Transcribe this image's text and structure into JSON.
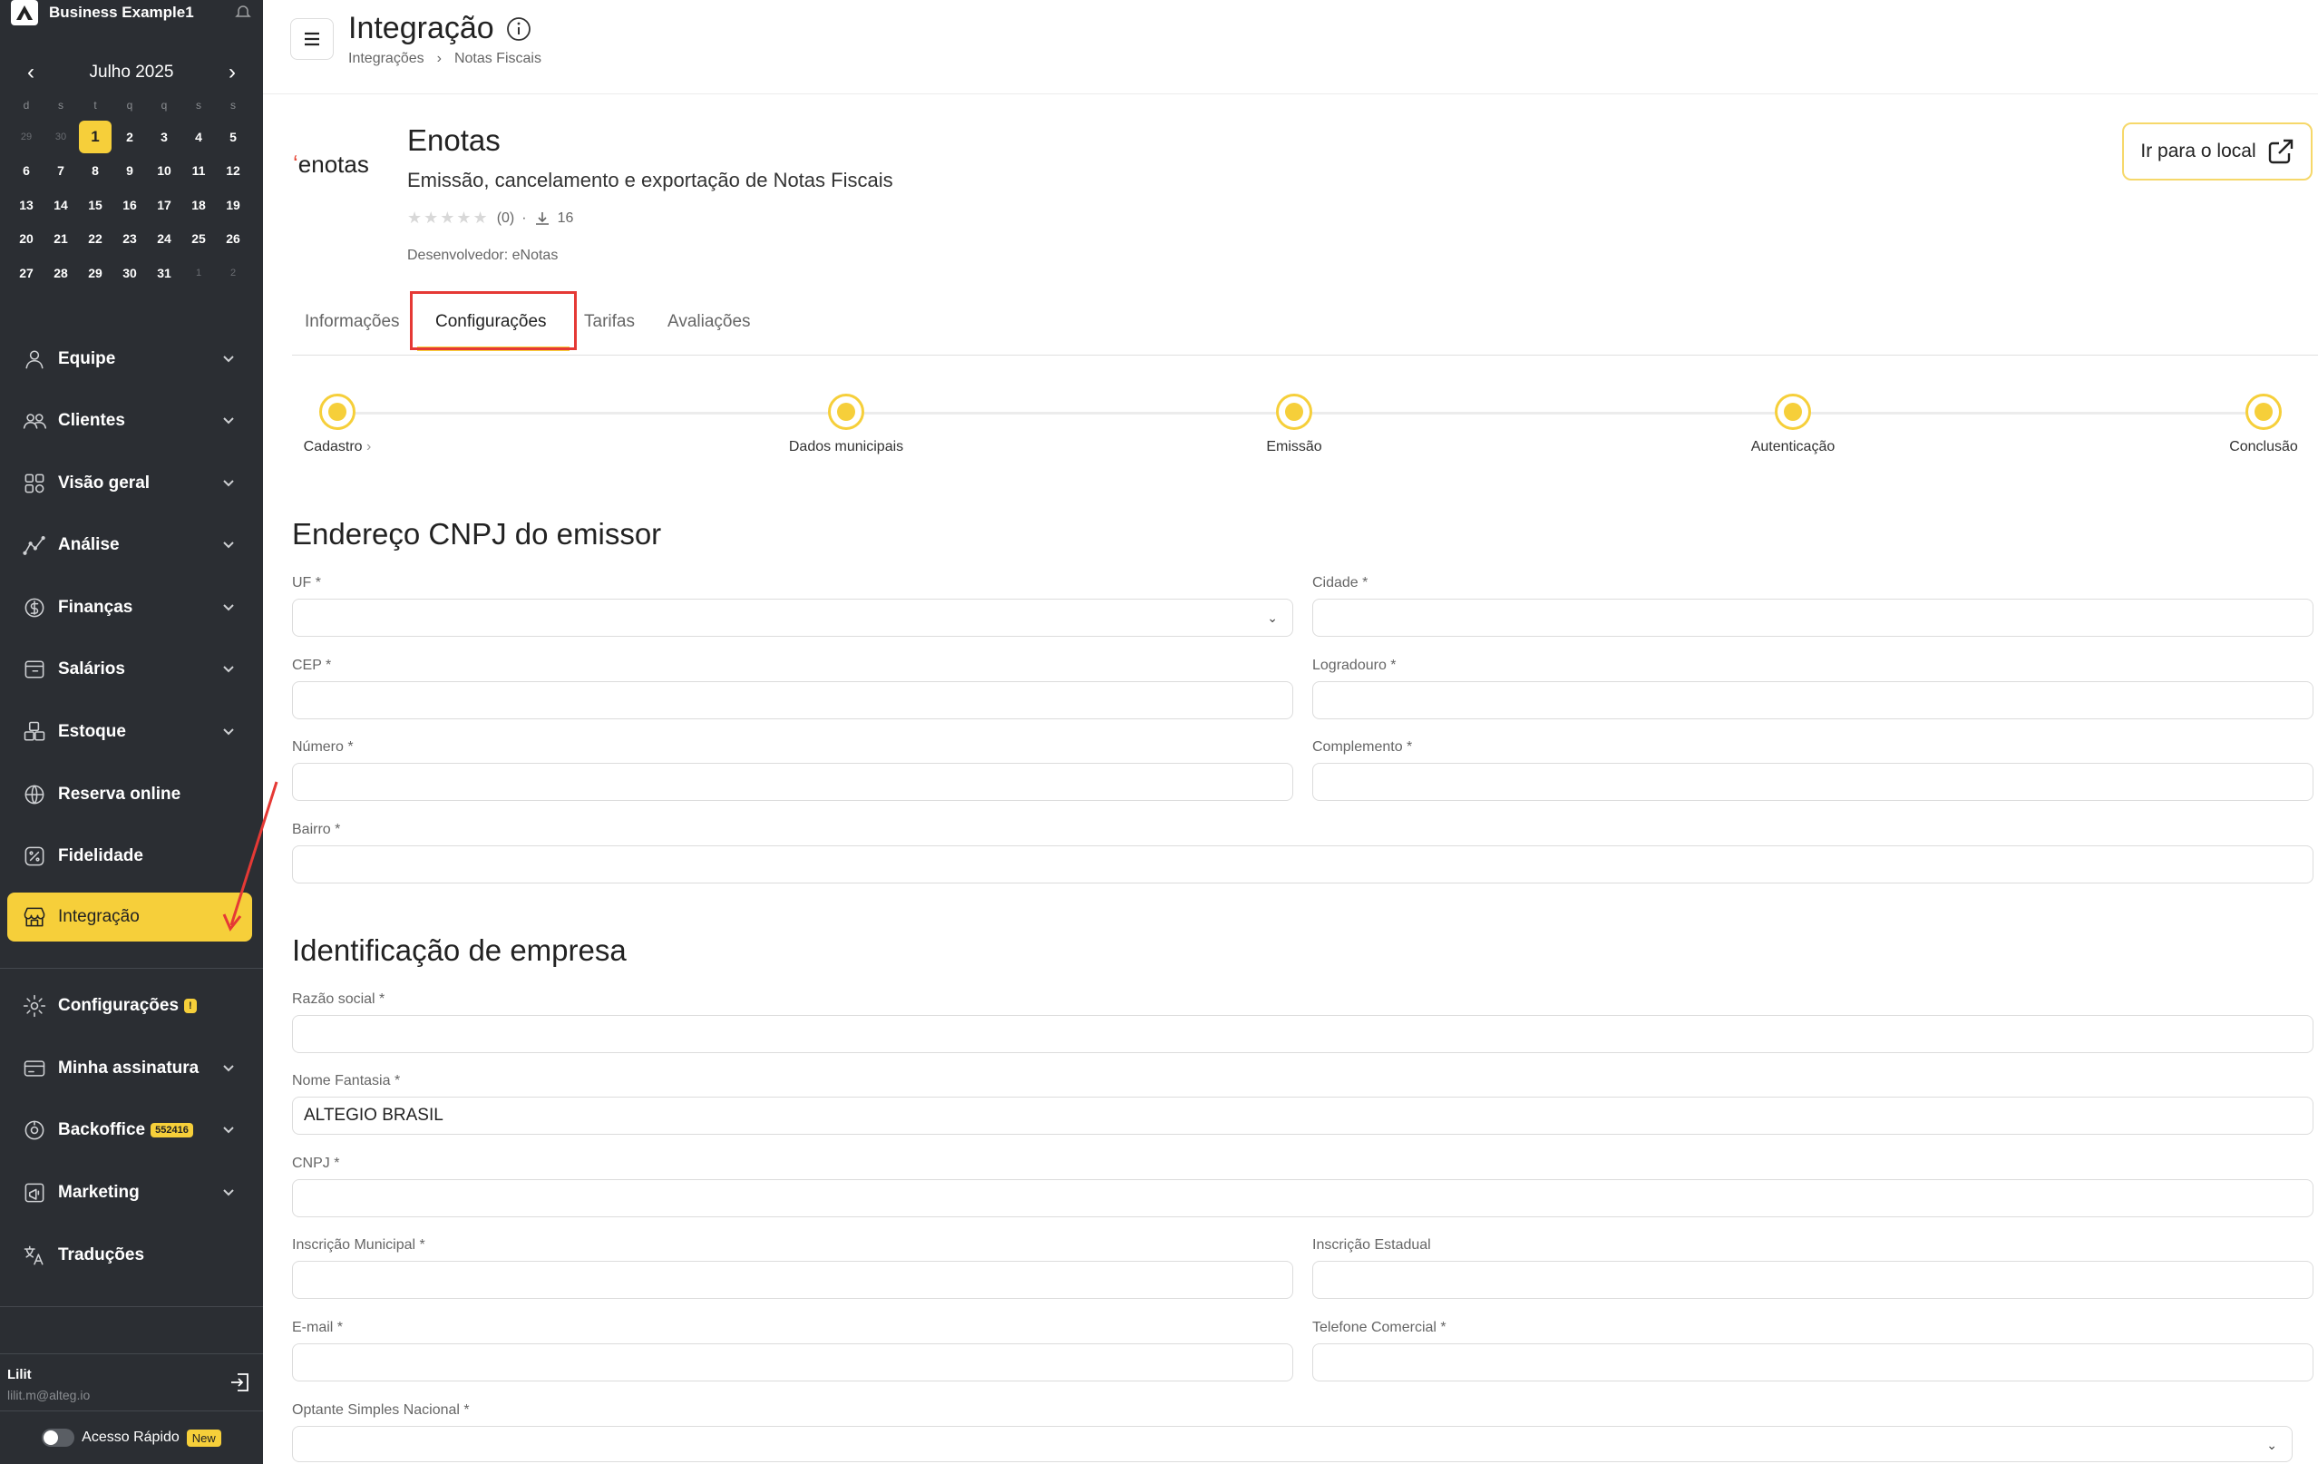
{
  "sidebar": {
    "business_name": "Business Example1",
    "calendar": {
      "month": "Julho 2025",
      "weekdays": [
        "d",
        "s",
        "t",
        "q",
        "q",
        "s",
        "s"
      ],
      "weeks": [
        [
          "29",
          "30",
          "1",
          "2",
          "3",
          "4",
          "5"
        ],
        [
          "6",
          "7",
          "8",
          "9",
          "10",
          "11",
          "12"
        ],
        [
          "13",
          "14",
          "15",
          "16",
          "17",
          "18",
          "19"
        ],
        [
          "20",
          "21",
          "22",
          "23",
          "24",
          "25",
          "26"
        ],
        [
          "27",
          "28",
          "29",
          "30",
          "31",
          "1",
          "2"
        ]
      ],
      "today": "1"
    },
    "items": [
      {
        "label": "Equipe",
        "icon": "user-icon"
      },
      {
        "label": "Clientes",
        "icon": "users-icon"
      },
      {
        "label": "Visão geral",
        "icon": "grid-icon"
      },
      {
        "label": "Análise",
        "icon": "chart-icon"
      },
      {
        "label": "Finanças",
        "icon": "dollar-icon"
      },
      {
        "label": "Salários",
        "icon": "wallet-icon"
      },
      {
        "label": "Estoque",
        "icon": "boxes-icon"
      },
      {
        "label": "Reserva online",
        "icon": "globe-icon"
      },
      {
        "label": "Fidelidade",
        "icon": "percent-icon"
      },
      {
        "label": "Integração",
        "icon": "store-icon"
      },
      {
        "label": "Configurações",
        "icon": "gear-icon",
        "badge": "!"
      },
      {
        "label": "Minha assinatura",
        "icon": "card-icon"
      },
      {
        "label": "Backoffice",
        "icon": "dial-icon",
        "badge": "552416"
      },
      {
        "label": "Marketing",
        "icon": "megaphone-icon"
      },
      {
        "label": "Traduções",
        "icon": "translate-icon"
      }
    ],
    "user": {
      "name": "Lilit",
      "email": "lilit.m@alteg.io"
    },
    "quick_access": {
      "label": "Acesso Rápido",
      "badge": "New"
    }
  },
  "header": {
    "title": "Integração",
    "breadcrumb": [
      "Integrações",
      "Notas Fiscais"
    ]
  },
  "app": {
    "logo_text": "enotas",
    "name": "Enotas",
    "description": "Emissão, cancelamento e exportação de Notas Fiscais",
    "rating_count": "(0)",
    "downloads": "16",
    "developer": "Desenvolvedor: eNotas",
    "go_button": "Ir para o local"
  },
  "tabs": [
    "Informações",
    "Configurações",
    "Tarifas",
    "Avaliações"
  ],
  "steps": [
    "Cadastro",
    "Dados municipais",
    "Emissão",
    "Autenticação",
    "Conclusão"
  ],
  "address_section": {
    "title": "Endereço CNPJ do emissor",
    "fields": {
      "uf": {
        "label": "UF *",
        "value": ""
      },
      "cidade": {
        "label": "Cidade *",
        "value": ""
      },
      "cep": {
        "label": "CEP *",
        "value": ""
      },
      "logradouro": {
        "label": "Logradouro *",
        "value": ""
      },
      "numero": {
        "label": "Número *",
        "value": ""
      },
      "complemento": {
        "label": "Complemento *",
        "value": ""
      },
      "bairro": {
        "label": "Bairro *",
        "value": ""
      }
    }
  },
  "company_section": {
    "title": "Identificação de empresa",
    "fields": {
      "razao": {
        "label": "Razão social *",
        "value": ""
      },
      "fantasia": {
        "label": "Nome Fantasia *",
        "value": "ALTEGIO BRASIL"
      },
      "cnpj": {
        "label": "CNPJ *",
        "value": ""
      },
      "im": {
        "label": "Inscrição Municipal *",
        "value": ""
      },
      "ie": {
        "label": "Inscrição Estadual",
        "value": ""
      },
      "email": {
        "label": "E-mail *",
        "value": ""
      },
      "telefone": {
        "label": "Telefone Comercial *",
        "value": ""
      },
      "simples": {
        "label": "Optante Simples Nacional *",
        "value": ""
      }
    }
  },
  "colors": {
    "accent": "#f6cf3a",
    "sidebar": "#2b2e33",
    "highlight": "#e53935"
  }
}
